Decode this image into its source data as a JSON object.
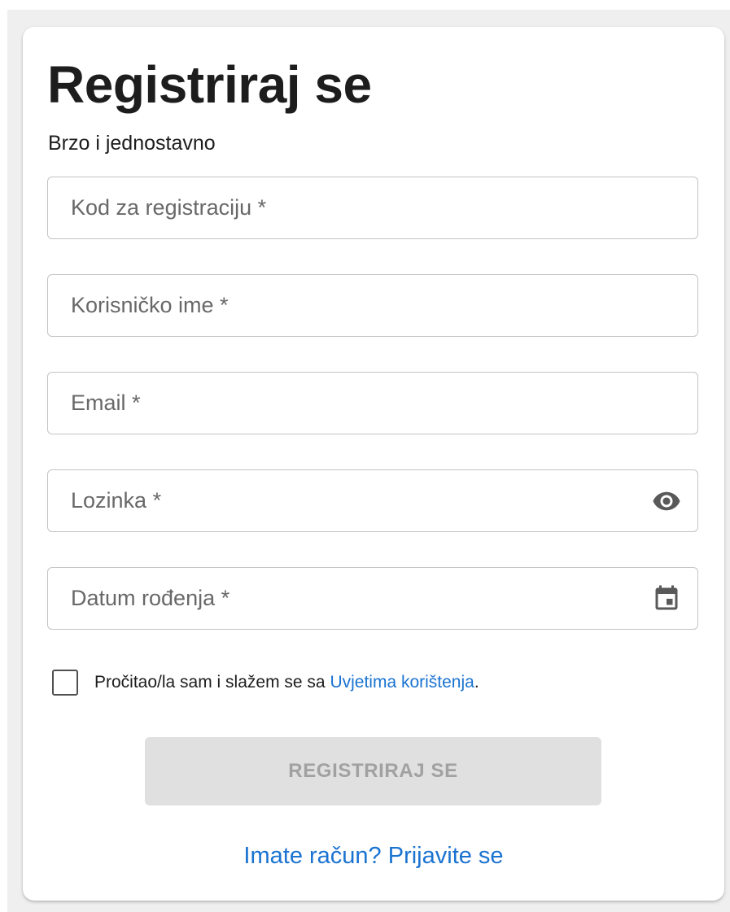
{
  "form": {
    "title": "Registriraj se",
    "subtitle": "Brzo i jednostavno",
    "fields": [
      {
        "placeholder": "Kod za registraciju *",
        "value": ""
      },
      {
        "placeholder": "Korisničko ime *",
        "value": ""
      },
      {
        "placeholder": "Email *",
        "value": ""
      },
      {
        "placeholder": "Lozinka *",
        "value": "",
        "trailing_icon": "eye-icon"
      },
      {
        "placeholder": "Datum rođenja *",
        "value": "",
        "trailing_icon": "calendar-icon"
      }
    ],
    "consent": {
      "checked": false,
      "text_before": "Pročitao/la sam i slažem se sa ",
      "link_text": "Uvjetima korištenja",
      "text_after": "."
    },
    "submit_label": "REGISTRIRAJ SE",
    "submit_disabled": true,
    "login_link": "Imate račun? Prijavite se"
  },
  "colors": {
    "link": "#1a73d1",
    "button_disabled_bg": "#e0e0e0",
    "button_disabled_text": "#a1a1a1",
    "field_border": "#c4c4c4",
    "page_background": "#efefef"
  }
}
